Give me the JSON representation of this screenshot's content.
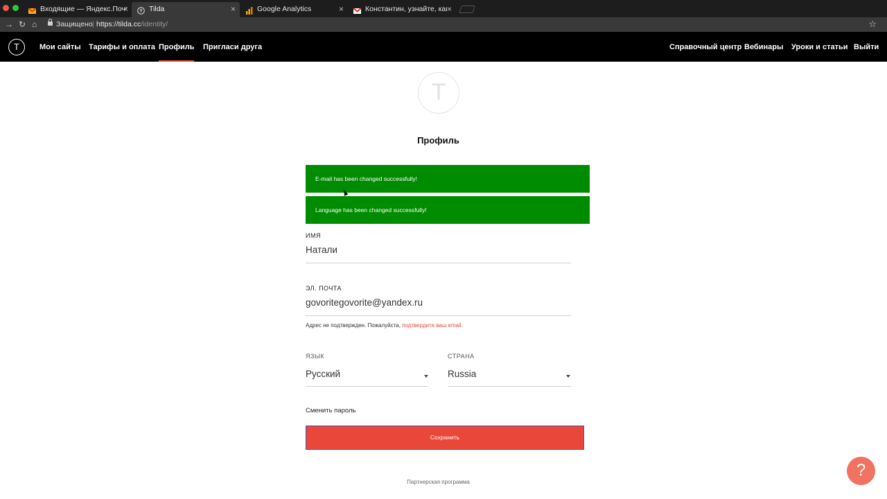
{
  "browser": {
    "tabs": [
      {
        "title": "Входящие — Яндекс.Почта",
        "icon": "gmail-icon",
        "active": false
      },
      {
        "title": "Tilda",
        "icon": "tilda-icon",
        "active": true
      },
      {
        "title": "Google Analytics",
        "icon": "analytics-icon",
        "active": false
      },
      {
        "title": "Константин, узнайте, какие н",
        "icon": "gmail-icon",
        "active": false
      }
    ],
    "close_glyph": "×",
    "address": {
      "secure_label": "Защищено",
      "url_host": "https://tilda.cc",
      "url_path": "/identity/"
    }
  },
  "header": {
    "logo": "Т",
    "nav_left": [
      "Мои сайты",
      "Тарифы и оплата",
      "Профиль",
      "Пригласи друга"
    ],
    "nav_right": [
      "Справочный центр",
      "Вебинары",
      "Уроки и статьи",
      "Выйти"
    ],
    "active_item": "Профиль",
    "accent_color": "#e8473a"
  },
  "profile": {
    "avatar_glyph": "Т",
    "title": "Профиль",
    "alerts": [
      "E-mail has been changed successfully!",
      "Language has been changed successfully!"
    ],
    "alert_color": "#008c00",
    "name_label": "ИМЯ",
    "name_value": "Натали",
    "email_label": "ЭЛ. ПОЧТА",
    "email_value": "govoritegovorite@yandex.ru",
    "email_hint": "Адрес не подтвержден. Пожалуйста,",
    "email_hint_link": "подтвердите ваш email.",
    "language_label": "ЯЗЫК",
    "language_value": "Русский",
    "country_label": "СТРАНА",
    "country_value": "Russia",
    "change_password": "Сменить пароль",
    "save_button": "Сохранить"
  },
  "footer": {
    "partner_link": "Партнерская программа"
  },
  "help_button": "?"
}
